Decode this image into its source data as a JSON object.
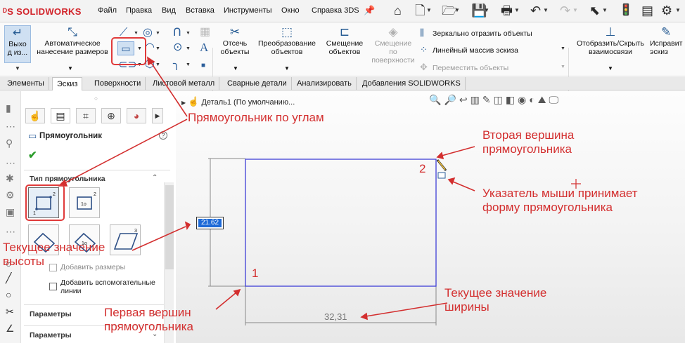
{
  "app": {
    "name": "SOLIDWORKS"
  },
  "menubar": {
    "items": [
      "Файл",
      "Правка",
      "Вид",
      "Вставка",
      "Инструменты",
      "Окно",
      "Справка 3DS"
    ]
  },
  "commandmanager": {
    "exit_sketch": "Выхо\nд из...",
    "smart_dimension": "Автоматическое\nнанесение размеров",
    "trim": "Отсечь\nобъекты",
    "convert": "Преобразование\nобъектов",
    "offset": "Смещение\nобъектов",
    "offset_on_surface": "Смещение\nпо\nповерхности",
    "mirror": "Зеркально отразить объекты",
    "linear_pattern": "Линейный массив эскиза",
    "move": "Переместить объекты",
    "display_relations": "Отобразить/Скрыть\nвзаимосвязи",
    "repair": "Исправит\nэскиз"
  },
  "tabs": [
    "Элементы",
    "Эскиз",
    "Поверхности",
    "Листовой металл",
    "Сварные детали",
    "Анализировать",
    "Добавления SOLIDWORKS"
  ],
  "active_tab": "Эскиз",
  "feature_tree": {
    "node": "Деталь1 (По умолчанию..."
  },
  "property_manager": {
    "title": "Прямоугольник",
    "section_rect_type": "Тип прямоугольника",
    "add_dims_label": "Добавить размеры",
    "construction_label": "Добавить вспомогательные линии",
    "params_1": "Параметры",
    "params_2": "Параметры"
  },
  "sketch": {
    "height_value": "21.62",
    "width_value": "32,31",
    "corner1": "1",
    "corner2": "2"
  },
  "annotations": {
    "corner_rect": "Прямоугольник по углам",
    "second_vertex": "Вторая вершина\nпрямоугольника",
    "cursor_shape": "Указатель мыши принимает\nформу прямоугольника",
    "current_height": "Текущее значение\nвысоты",
    "current_width": "Текущее значение\nширины",
    "first_vertex": "Первая вершин\nпрямоугольника"
  },
  "colors": {
    "accent_red": "#d32f2f",
    "sketch_blue": "#3f3fd6",
    "dim_highlight": "#1e6ad7"
  }
}
